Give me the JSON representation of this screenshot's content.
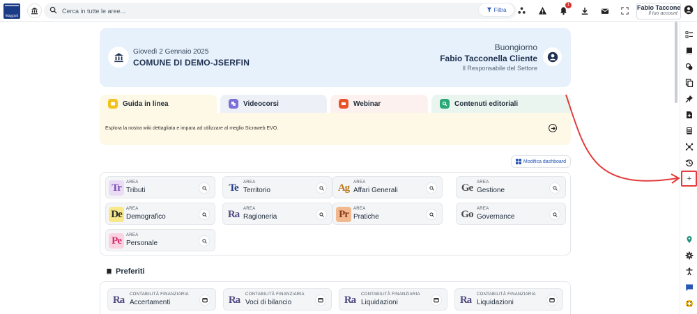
{
  "topbar": {
    "logo_text": "Maggioli",
    "search_placeholder": "Cerca in tutte le aree...",
    "filter_label": "Filtra",
    "notification_count": "1",
    "account_name": "Fabio Tacconelli...",
    "account_sub": "Il tuo account"
  },
  "hero": {
    "date": "Giovedì 2 Gennaio 2025",
    "entity": "COMUNE DI DEMO-JSERFIN",
    "greeting": "Buongiorno",
    "user": "Fabio Tacconella Cliente",
    "role": "Il Responsabile del Settore"
  },
  "tabs": [
    {
      "label": "Guida in linea",
      "color": "#f3c21d",
      "bg": "#fef9e6"
    },
    {
      "label": "Videocorsi",
      "color": "#7b6fd8",
      "bg": "#eef0f8"
    },
    {
      "label": "Webinar",
      "color": "#e8542a",
      "bg": "#fdf1ef"
    },
    {
      "label": "Contenuti editoriali",
      "color": "#2aa876",
      "bg": "#eaf5ef"
    }
  ],
  "tab_panel": {
    "description": "Esplora la nostra wiki dettagliata e impara ad utilizzare al meglio Sicraweb EVO."
  },
  "edit_dashboard_label": "Modifica dashboard",
  "areas": {
    "caption": "AREA",
    "items": [
      {
        "mono": "Tr",
        "name": "Tributi",
        "color": "#7a4fb3",
        "bg": "#e9dcf4"
      },
      {
        "mono": "Te",
        "name": "Territorio",
        "color": "#233b8a",
        "bg": "#f4f5f7"
      },
      {
        "mono": "Ag",
        "name": "Affari Generali",
        "color": "#b8791b",
        "bg": "#f4f5f7"
      },
      {
        "mono": "Ge",
        "name": "Gestione",
        "color": "#4a4a4a",
        "bg": "#f4f5f7"
      },
      {
        "mono": "De",
        "name": "Demografico",
        "color": "#2a2a2a",
        "bg": "#f7e98a"
      },
      {
        "mono": "Ra",
        "name": "Ragioneria",
        "color": "#4f4a82",
        "bg": "#f4f5f7"
      },
      {
        "mono": "Pr",
        "name": "Pratiche",
        "color": "#8a3a1c",
        "bg": "#f3b98e"
      },
      {
        "mono": "Go",
        "name": "Governance",
        "color": "#4a4a4a",
        "bg": "#f4f5f7"
      },
      {
        "mono": "Pe",
        "name": "Personale",
        "color": "#d42d6a",
        "bg": "#fbd3e0"
      }
    ]
  },
  "favorites": {
    "title": "Preferiti",
    "items": [
      {
        "mono": "Ra",
        "caption": "CONTABILITÀ FINANZIARIA",
        "name": "Accertamenti"
      },
      {
        "mono": "Ra",
        "caption": "CONTABILITÀ FINANZIARIA",
        "name": "Voci di bilancio"
      },
      {
        "mono": "Ra",
        "caption": "CONTABILITÀ FINANZIARIA",
        "name": "Liquidazioni"
      },
      {
        "mono": "Ra",
        "caption": "CONTABILITÀ FINANZIARIA",
        "name": "Liquidazioni"
      }
    ]
  },
  "sidebar": {
    "add_label": "+"
  },
  "colors": {
    "accent": "#2657b5",
    "annotation": "#e33c3c"
  }
}
